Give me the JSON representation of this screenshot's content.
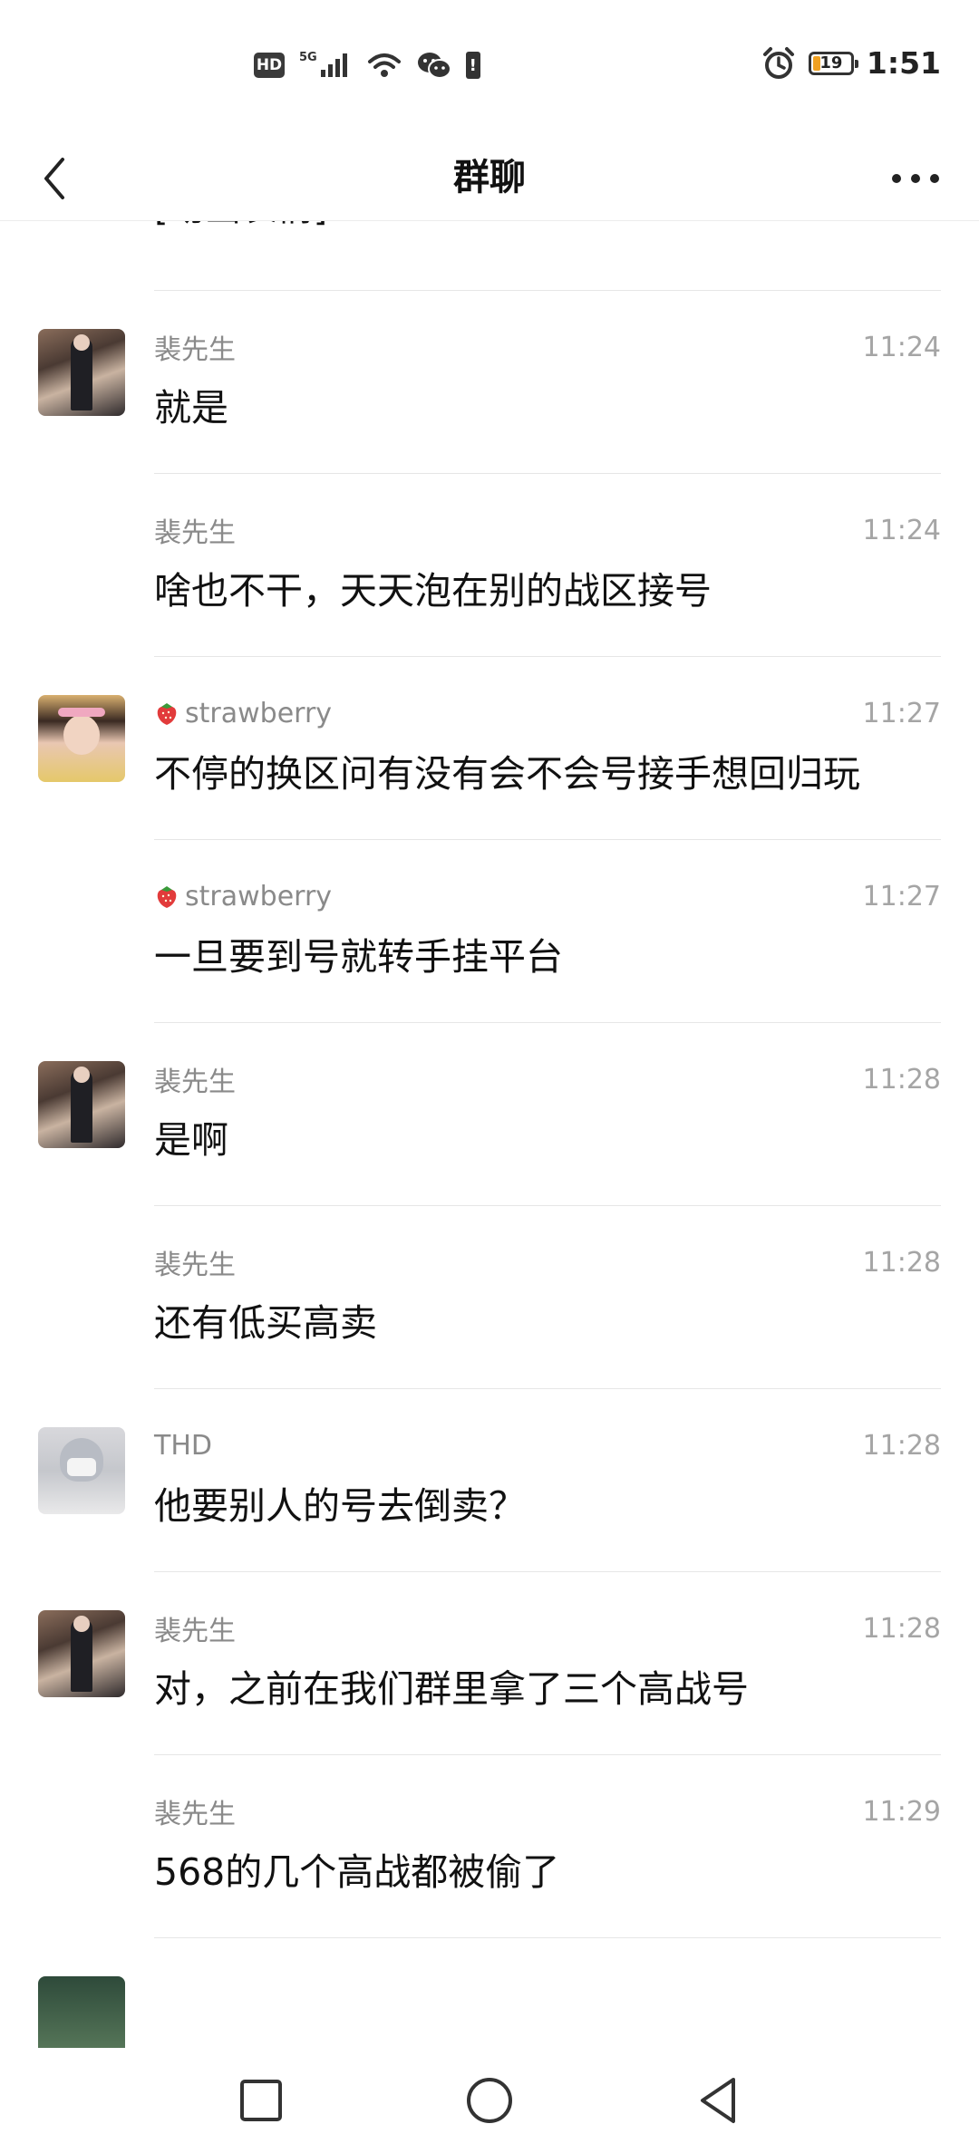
{
  "status_bar": {
    "hd": "HD",
    "network": "5G",
    "battery_level": "19",
    "time": "1:51"
  },
  "header": {
    "title": "群聊"
  },
  "partial_top_message": "[动画表情]",
  "messages": [
    {
      "sender": "裴先生",
      "time": "11:24",
      "text": "就是",
      "avatar": "pei"
    },
    {
      "sender": "裴先生",
      "time": "11:24",
      "text": "啥也不干，天天泡在别的战区接号",
      "avatar": ""
    },
    {
      "sender": "strawberry",
      "time": "11:27",
      "text": "不停的换区问有没有会不会号接手想回归玩",
      "avatar": "straw",
      "sender_icon": "strawberry-icon"
    },
    {
      "sender": "strawberry",
      "time": "11:27",
      "text": "一旦要到号就转手挂平台",
      "avatar": "",
      "sender_icon": "strawberry-icon"
    },
    {
      "sender": "裴先生",
      "time": "11:28",
      "text": "是啊",
      "avatar": "pei"
    },
    {
      "sender": "裴先生",
      "time": "11:28",
      "text": "还有低买高卖",
      "avatar": ""
    },
    {
      "sender": "THD",
      "time": "11:28",
      "text": "他要别人的号去倒卖？",
      "avatar": "thd"
    },
    {
      "sender": "裴先生",
      "time": "11:28",
      "text": "对，之前在我们群里拿了三个高战号",
      "avatar": "pei"
    },
    {
      "sender": "裴先生",
      "time": "11:29",
      "text": "568的几个高战都被偷了",
      "avatar": ""
    },
    {
      "sender": "",
      "time": "",
      "text": "",
      "avatar": "green"
    }
  ],
  "icons": {
    "back": "back-arrow-icon",
    "more": "more-dots-icon",
    "recents": "square-icon",
    "home": "circle-icon",
    "back_nav": "triangle-back-icon"
  },
  "colors": {
    "accent": "#111111",
    "meta": "#8a8a8a",
    "divider": "#e6e6e6",
    "battery_low": "#f0a020"
  }
}
